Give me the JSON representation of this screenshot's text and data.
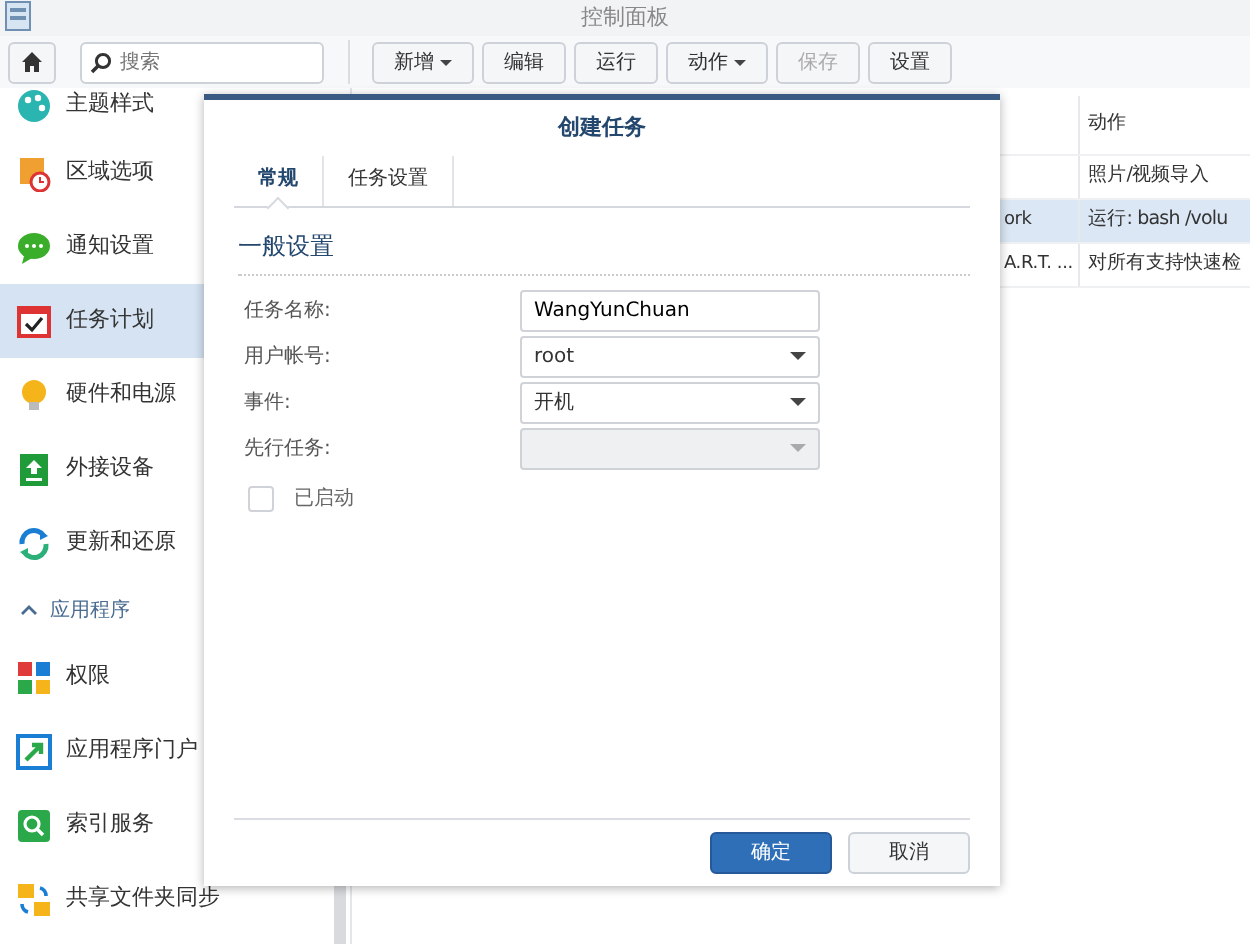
{
  "window": {
    "title": "控制面板"
  },
  "toolbar": {
    "search": {
      "placeholder": "搜索"
    },
    "buttons": [
      {
        "label": "新增",
        "dropdown": true,
        "disabled": false
      },
      {
        "label": "编辑",
        "dropdown": false,
        "disabled": false
      },
      {
        "label": "运行",
        "dropdown": false,
        "disabled": false
      },
      {
        "label": "动作",
        "dropdown": true,
        "disabled": false
      },
      {
        "label": "保存",
        "dropdown": false,
        "disabled": true
      },
      {
        "label": "设置",
        "dropdown": false,
        "disabled": false
      }
    ]
  },
  "sidebar": {
    "items": [
      {
        "kind": "item",
        "label": "主题样式",
        "selected": false
      },
      {
        "kind": "item",
        "label": "区域选项",
        "selected": false
      },
      {
        "kind": "item",
        "label": "通知设置",
        "selected": false
      },
      {
        "kind": "item",
        "label": "任务计划",
        "selected": true
      },
      {
        "kind": "item",
        "label": "硬件和电源",
        "selected": false
      },
      {
        "kind": "item",
        "label": "外接设备",
        "selected": false
      },
      {
        "kind": "item",
        "label": "更新和还原",
        "selected": false
      },
      {
        "kind": "section",
        "label": "应用程序",
        "expanded": true
      },
      {
        "kind": "item",
        "label": "权限",
        "selected": false
      },
      {
        "kind": "item",
        "label": "应用程序门户",
        "selected": false
      },
      {
        "kind": "item",
        "label": "索引服务",
        "selected": false
      },
      {
        "kind": "item",
        "label": "共享文件夹同步",
        "selected": false
      }
    ]
  },
  "table": {
    "columns": [
      {
        "label": "动作"
      }
    ],
    "rows": [
      {
        "selected": false,
        "action": "照片/视频导入"
      },
      {
        "selected": true,
        "column_1": "ork",
        "action": "运行: bash /volu"
      },
      {
        "selected": false,
        "column_1": "A.R.T. ...",
        "action": "对所有支持快速检"
      }
    ]
  },
  "dialog": {
    "title": "创建任务",
    "tabs": [
      {
        "label": "常规",
        "selected": true
      },
      {
        "label": "任务设置",
        "selected": false
      }
    ],
    "section": "一般设置",
    "fields": [
      {
        "kind": "text",
        "label": "任务名称:",
        "value": "WangYunChuan",
        "disabled": false
      },
      {
        "kind": "select",
        "label": "用户帐号:",
        "value": "root",
        "disabled": false
      },
      {
        "kind": "select",
        "label": "事件:",
        "value": "开机",
        "disabled": false
      },
      {
        "kind": "select",
        "label": "先行任务:",
        "disabled": true
      }
    ],
    "checkbox": {
      "label": "已启动",
      "checked": false
    },
    "buttons": [
      {
        "label": "确定",
        "primary": true
      },
      {
        "label": "取消",
        "primary": false
      }
    ]
  }
}
